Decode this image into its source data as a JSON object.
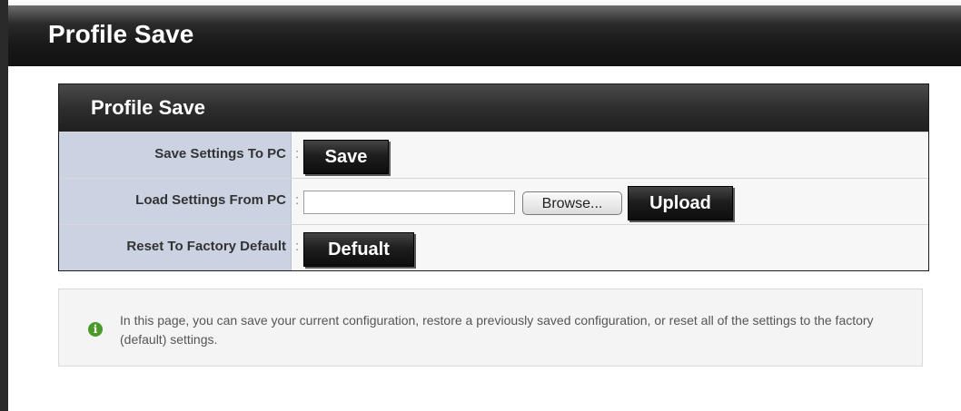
{
  "page": {
    "title": "Profile Save"
  },
  "panel": {
    "title": "Profile Save",
    "rows": [
      {
        "label": "Save Settings To PC",
        "separator": ":",
        "button": "Save"
      },
      {
        "label": "Load Settings From PC",
        "separator": ":",
        "file_value": "",
        "browse_label": "Browse...",
        "button": "Upload"
      },
      {
        "label": "Reset To Factory Default",
        "separator": ":",
        "button": "Defualt"
      }
    ]
  },
  "info": {
    "icon": "info-icon",
    "text": "In this page, you can save your current configuration, restore a previously saved configuration, or reset all of the settings to the factory (default) settings."
  },
  "colors": {
    "header_bg": "#1a1a1a",
    "label_bg": "#cbd3e3",
    "info_icon": "#4a9a2a"
  }
}
